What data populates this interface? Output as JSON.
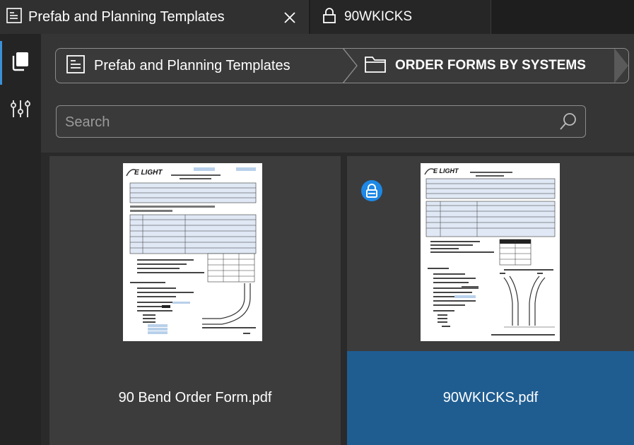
{
  "tabs": [
    {
      "label": "Prefab and Planning Templates",
      "icon": "document-lines-icon",
      "active": true
    },
    {
      "label": "90WKICKS",
      "icon": "lock-icon",
      "active": false
    }
  ],
  "rail": {
    "items": [
      {
        "icon": "pages-icon",
        "active": true
      },
      {
        "icon": "sliders-icon",
        "active": false
      }
    ]
  },
  "breadcrumb": [
    {
      "label": "Prefab and Planning Templates",
      "icon": "document-lines-icon"
    },
    {
      "label": "ORDER FORMS BY SYSTEMS",
      "icon": "folder-icon"
    }
  ],
  "search": {
    "placeholder": "Search",
    "value": ""
  },
  "files": [
    {
      "name": "90 Bend Order Form.pdf",
      "locked": false,
      "selected": false,
      "thumb_brand": "E LIGHT"
    },
    {
      "name": "90WKICKS.pdf",
      "locked": true,
      "selected": true,
      "thumb_brand": "E LIGHT"
    }
  ],
  "colors": {
    "accent": "#3d8fd6",
    "selected": "#1f5d91",
    "lock_badge": "#1e88e5"
  }
}
